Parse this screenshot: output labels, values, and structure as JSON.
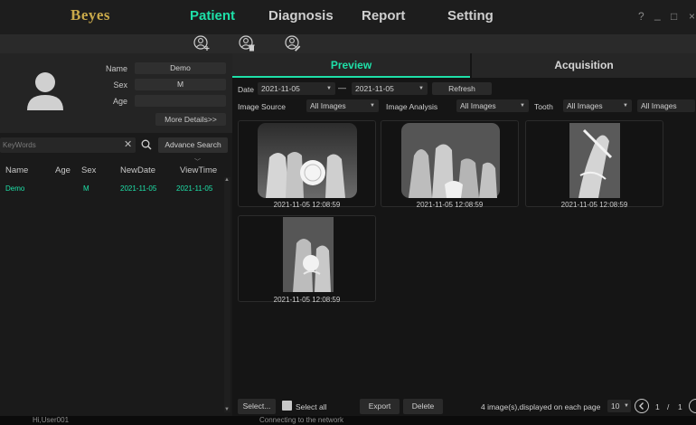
{
  "app": {
    "logo": "Beyes"
  },
  "nav": {
    "tabs": [
      {
        "label": "Patient",
        "active": true
      },
      {
        "label": "Diagnosis"
      },
      {
        "label": "Report"
      },
      {
        "label": "Setting"
      }
    ],
    "help": "?",
    "minimize": "_",
    "maximize": "□",
    "close": "×"
  },
  "toolbar": {
    "icons": [
      "add-patient-icon",
      "delete-patient-icon",
      "edit-patient-icon"
    ]
  },
  "patient_info": {
    "name_label": "Name",
    "name_value": "Demo",
    "sex_label": "Sex",
    "sex_value": "M",
    "age_label": "Age",
    "age_value": "",
    "more_details": "More Details>>"
  },
  "search": {
    "placeholder": "KeyWords",
    "advanced": "Advance Search"
  },
  "patient_list": {
    "columns": [
      "Name",
      "Age",
      "Sex",
      "NewDate",
      "ViewTime"
    ],
    "rows": [
      {
        "name": "Demo",
        "age": "",
        "sex": "M",
        "new_date": "2021-11-05",
        "view_time": "2021-11-05"
      }
    ]
  },
  "right_tabs": {
    "preview": "Preview",
    "acquisition": "Acquisition"
  },
  "filters": {
    "date_label": "Date",
    "date_from": "2021-11-05",
    "date_to": "2021-11-05",
    "dash": "—",
    "refresh": "Refresh",
    "image_source_label": "Image Source",
    "image_source_value": "All Images",
    "image_analysis_label": "Image Analysis",
    "image_analysis_value": "All Images",
    "tooth_label": "Tooth",
    "tooth_value": "All Images",
    "extra_value": "All Images"
  },
  "thumbnails": [
    {
      "caption": "2021-11-05 12:08:59"
    },
    {
      "caption": "2021-11-05 12:08:59"
    },
    {
      "caption": "2021-11-05 12:08:59"
    },
    {
      "caption": "2021-11-05 12:08:59"
    }
  ],
  "bottom": {
    "select": "Select...",
    "select_all": "Select all",
    "export": "Export",
    "delete": "Delete",
    "count_text": "4 image(s),displayed on each page",
    "per_page": "10",
    "page_current": "1",
    "page_sep": "/",
    "page_total": "1"
  },
  "status": {
    "user": "Hi,User001",
    "network": "Connecting to the network"
  },
  "colors": {
    "accent": "#1ee0a8",
    "logo": "#c9a94a",
    "background": "#141414"
  }
}
